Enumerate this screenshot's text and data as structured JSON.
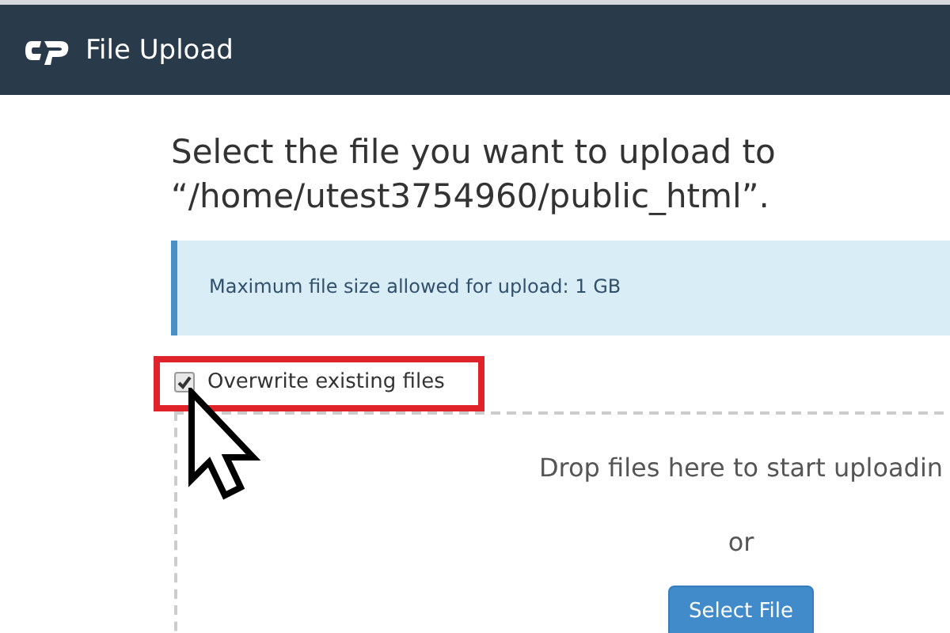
{
  "header": {
    "title": "File Upload"
  },
  "heading": {
    "line_1": "Select the file you want to upload to",
    "line_2": "“/home/utest3754960/public_html”."
  },
  "info": {
    "text": "Maximum file size allowed for upload: 1 GB"
  },
  "overwrite": {
    "label": "Overwrite existing files",
    "checked": true
  },
  "dropzone": {
    "text": "Drop files here to start uploadin",
    "separator": "or",
    "button": "Select File"
  }
}
